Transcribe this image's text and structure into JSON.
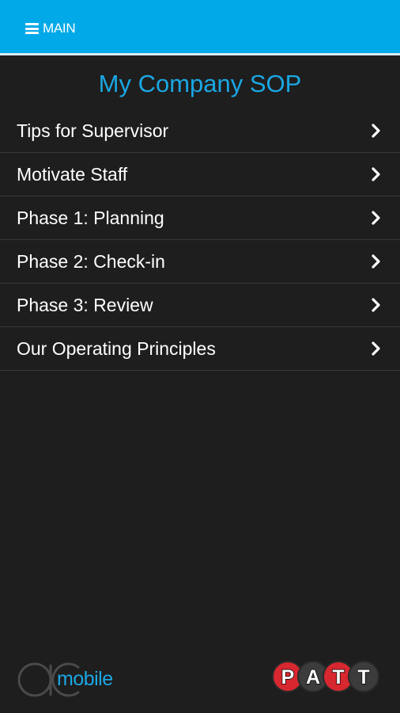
{
  "header": {
    "menu_label": "MAIN",
    "menu_icon": "hamburger-icon"
  },
  "page": {
    "title": "My Company SOP"
  },
  "menu": {
    "items": [
      {
        "label": "Tips for Supervisor",
        "icon": "chevron-right-icon"
      },
      {
        "label": "Motivate Staff",
        "icon": "chevron-right-icon"
      },
      {
        "label": "Phase 1: Planning",
        "icon": "chevron-right-icon"
      },
      {
        "label": "Phase 2: Check-in",
        "icon": "chevron-right-icon"
      },
      {
        "label": "Phase 3: Review",
        "icon": "chevron-right-icon"
      },
      {
        "label": "Our Operating Principles",
        "icon": "chevron-right-icon"
      }
    ]
  },
  "footer": {
    "brand_text": "mobile",
    "logo_letters": [
      "P",
      "A",
      "T",
      "T"
    ]
  },
  "colors": {
    "header_bg": "#01a9e8",
    "body_bg": "#1e1e1e",
    "accent": "#1aa7e3",
    "divider": "#3a3a3a",
    "patt_red": "#d7272f",
    "patt_dark": "#3c3c3c"
  }
}
